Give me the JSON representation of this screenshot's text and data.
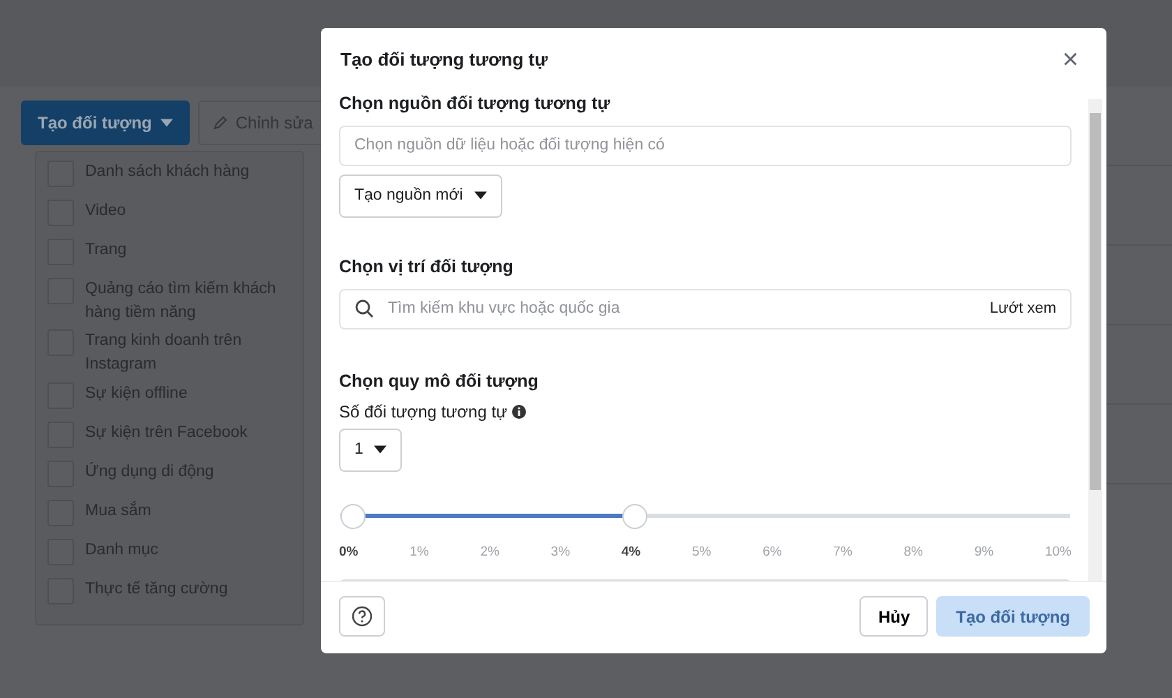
{
  "toolbar": {
    "create_button": "Tạo đối tượng",
    "edit_button": "Chỉnh sửa"
  },
  "source_list": [
    {
      "label": "Danh sách khách hàng",
      "checked": false
    },
    {
      "label": "Video",
      "checked": false
    },
    {
      "label": "Trang",
      "checked": false
    },
    {
      "label": "Quảng cáo tìm kiếm khách hàng tiềm năng",
      "checked": false
    },
    {
      "label": "Trang kinh doanh trên Instagram",
      "checked": false
    },
    {
      "label": "Sự kiện offline",
      "checked": false
    },
    {
      "label": "Sự kiện trên Facebook",
      "checked": false
    },
    {
      "label": "Ứng dụng di động",
      "checked": false
    },
    {
      "label": "Mua sắm",
      "checked": false
    },
    {
      "label": "Danh mục",
      "checked": false
    },
    {
      "label": "Thực tế tăng cường",
      "checked": false
    }
  ],
  "dialog": {
    "title": "Tạo đối tượng tương tự",
    "close": "×",
    "source": {
      "heading": "Chọn nguồn đối tượng tương tự",
      "placeholder": "Chọn nguồn dữ liệu hoặc đối tượng hiện có",
      "new_source_button": "Tạo nguồn mới"
    },
    "location": {
      "heading": "Chọn vị trí đối tượng",
      "placeholder": "Tìm kiếm khu vực hoặc quốc gia",
      "browse": "Lướt xem"
    },
    "size": {
      "heading": "Chọn quy mô đối tượng",
      "count_label": "Số đối tượng tương tự",
      "count_value": "1",
      "slider": {
        "level": 0.4,
        "ticks": [
          "0%",
          "1%",
          "2%",
          "3%",
          "4%",
          "5%",
          "6%",
          "7%",
          "8%",
          "9%",
          "10%"
        ]
      }
    },
    "footer": {
      "cancel": "Hủy",
      "submit": "Tạo đối tượng",
      "submit_disabled": true
    }
  }
}
